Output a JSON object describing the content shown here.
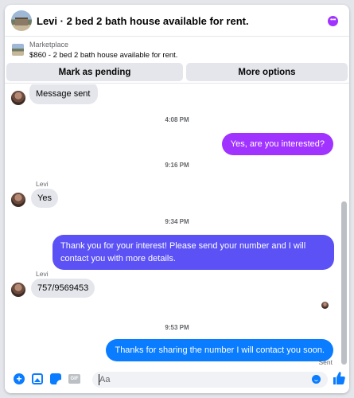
{
  "header": {
    "title": "Levi · 2 bed 2 bath house available for rent.",
    "menu_icon": "more-options-icon"
  },
  "marketplace": {
    "label": "Marketplace",
    "listing": "$860 - 2 bed 2 bath house available for rent.",
    "pending_button": "Mark as pending",
    "options_button": "More options"
  },
  "thread": {
    "messages": [
      {
        "from": "Levi",
        "text": "Message sent"
      },
      {
        "timestamp": "4:08 PM"
      },
      {
        "from": "me",
        "text": "Yes, are you interested?"
      },
      {
        "timestamp": "9:16 PM"
      },
      {
        "sender_name": "Levi",
        "from": "Levi",
        "text": "Yes"
      },
      {
        "timestamp": "9:34 PM"
      },
      {
        "from": "me",
        "text": "Thank you for your interest! Please send your number and I will contact you with more details."
      },
      {
        "sender_name": "Levi",
        "from": "Levi",
        "text": "757/9569453"
      },
      {
        "timestamp": "9:53 PM"
      },
      {
        "from": "me",
        "text": "Thanks for sharing the number I will contact you soon.",
        "status": "Sent"
      }
    ]
  },
  "composer": {
    "placeholder": "Aa",
    "icons": [
      "plus-icon",
      "photo-icon",
      "sticker-icon",
      "gif-icon",
      "emoji-icon",
      "thumbs-up-icon"
    ],
    "gif_label": "GIF"
  },
  "colors": {
    "accent_blue": "#0a7cff",
    "bubble_purple": "#a033ff",
    "bubble_indigo": "#5b51f5",
    "incoming_bubble": "#e4e6eb"
  }
}
